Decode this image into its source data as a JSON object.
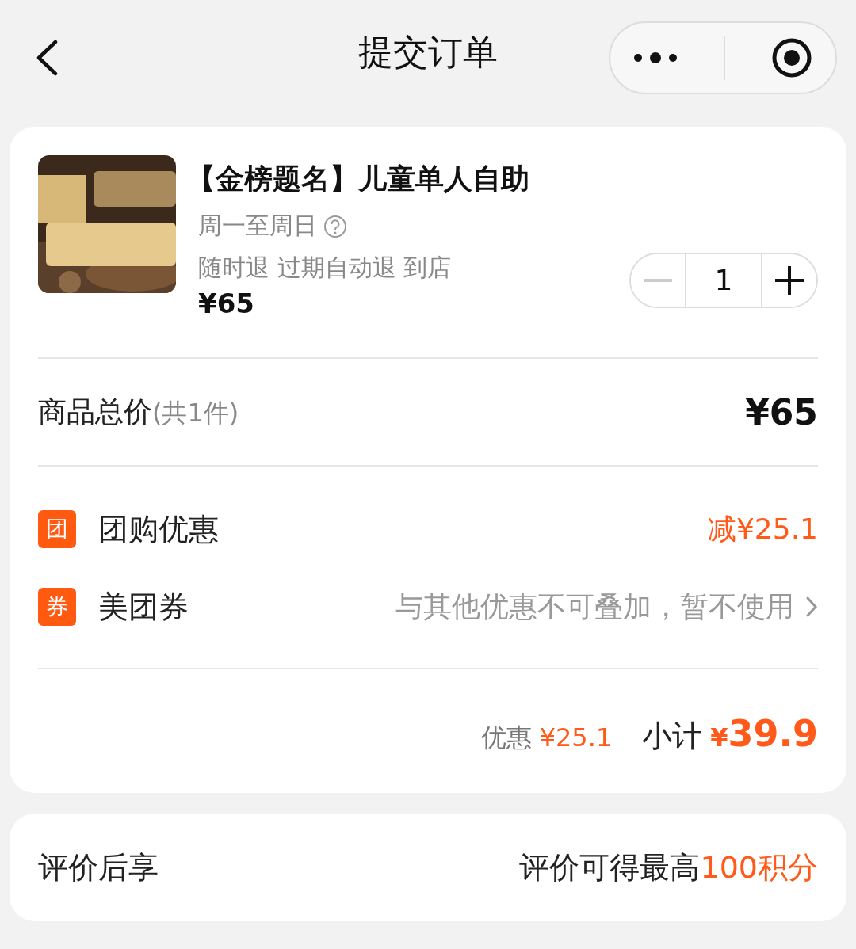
{
  "header": {
    "title": "提交订单"
  },
  "product": {
    "kind": "picture",
    "title": "【金榜题名】儿童单人自助",
    "schedule": "周一至周日",
    "policy": "随时退 过期自动退 到店",
    "price": "¥65",
    "quantity": "1",
    "minus_disabled": true
  },
  "total": {
    "label": "商品总价",
    "count": "(共1件)",
    "amount": "¥65"
  },
  "discounts": [
    {
      "kind": "discount",
      "badge": "团",
      "label": "团购优惠",
      "value": "减¥25.1"
    },
    {
      "kind": "link",
      "badge": "券",
      "label": "美团券",
      "value": "与其他优惠不可叠加，暂不使用"
    }
  ],
  "summary": {
    "discount_label": "优惠",
    "discount_value": "¥25.1",
    "subtotal_label": "小计",
    "subtotal_currency": "¥",
    "subtotal_value": "39.9"
  },
  "review": {
    "label": "评价后享",
    "text": "评价可得最高",
    "highlight": "100积分"
  }
}
